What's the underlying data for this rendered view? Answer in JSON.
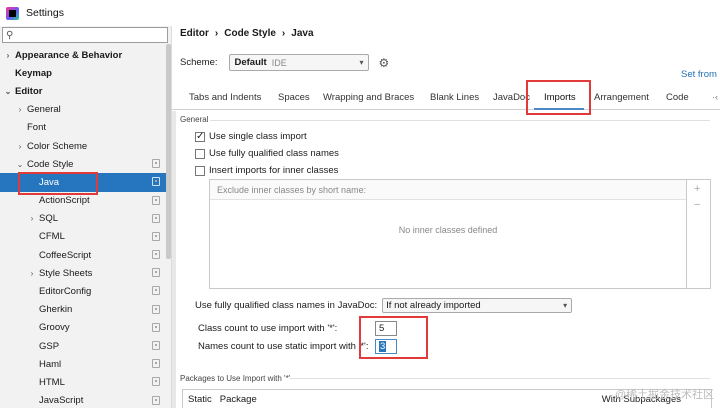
{
  "window": {
    "title": "Settings"
  },
  "sidebar": {
    "search_placeholder": "",
    "items": [
      {
        "label": "Appearance & Behavior",
        "arrow": "›"
      },
      {
        "label": "Keymap",
        "arrow": ""
      },
      {
        "label": "Editor",
        "arrow": "⌄"
      },
      {
        "label": "General",
        "arrow": "›"
      },
      {
        "label": "Font",
        "arrow": ""
      },
      {
        "label": "Color Scheme",
        "arrow": "›"
      },
      {
        "label": "Code Style",
        "arrow": "⌄"
      },
      {
        "label": "Java",
        "arrow": ""
      },
      {
        "label": "ActionScript",
        "arrow": ""
      },
      {
        "label": "SQL",
        "arrow": "›"
      },
      {
        "label": "CFML",
        "arrow": ""
      },
      {
        "label": "CoffeeScript",
        "arrow": ""
      },
      {
        "label": "Style Sheets",
        "arrow": "›"
      },
      {
        "label": "EditorConfig",
        "arrow": ""
      },
      {
        "label": "Gherkin",
        "arrow": ""
      },
      {
        "label": "Groovy",
        "arrow": ""
      },
      {
        "label": "GSP",
        "arrow": ""
      },
      {
        "label": "Haml",
        "arrow": ""
      },
      {
        "label": "HTML",
        "arrow": ""
      },
      {
        "label": "JavaScript",
        "arrow": ""
      }
    ]
  },
  "breadcrumb": {
    "part1": "Editor",
    "part2": "Code Style",
    "part3": "Java",
    "sep": "›"
  },
  "scheme": {
    "label": "Scheme:",
    "name": "Default",
    "tag": "IDE"
  },
  "set_from": "Set from",
  "tabs": [
    "Tabs and Indents",
    "Spaces",
    "Wrapping and Braces",
    "Blank Lines",
    "JavaDoc",
    "Imports",
    "Arrangement",
    "Code"
  ],
  "active_tab": "Imports",
  "general": {
    "section_label": "General",
    "use_single_class_import": {
      "label": "Use single class import",
      "checked": true
    },
    "use_fully_qualified": {
      "label": "Use fully qualified class names",
      "checked": false
    },
    "insert_imports_inner": {
      "label": "Insert imports for inner classes",
      "checked": false
    },
    "exclude_placeholder": "Exclude inner classes by short name:",
    "empty_text": "No inner classes defined"
  },
  "javadoc": {
    "label": "Use fully qualified class names in JavaDoc:",
    "value": "If not already imported"
  },
  "class_count": {
    "label": "Class count to use import with '*':",
    "value": "5"
  },
  "names_count": {
    "label": "Names count to use static import with '*':",
    "value": "3"
  },
  "packages": {
    "section_label": "Packages to Use Import with '*'",
    "col_static": "Static",
    "col_package": "Package",
    "col_sub": "With Subpackages"
  },
  "watermark": "@稀土掘金技术社区",
  "colors": {
    "selection": "#2675bf",
    "link": "#2470b3",
    "highlight_box": "#e03a3a"
  }
}
